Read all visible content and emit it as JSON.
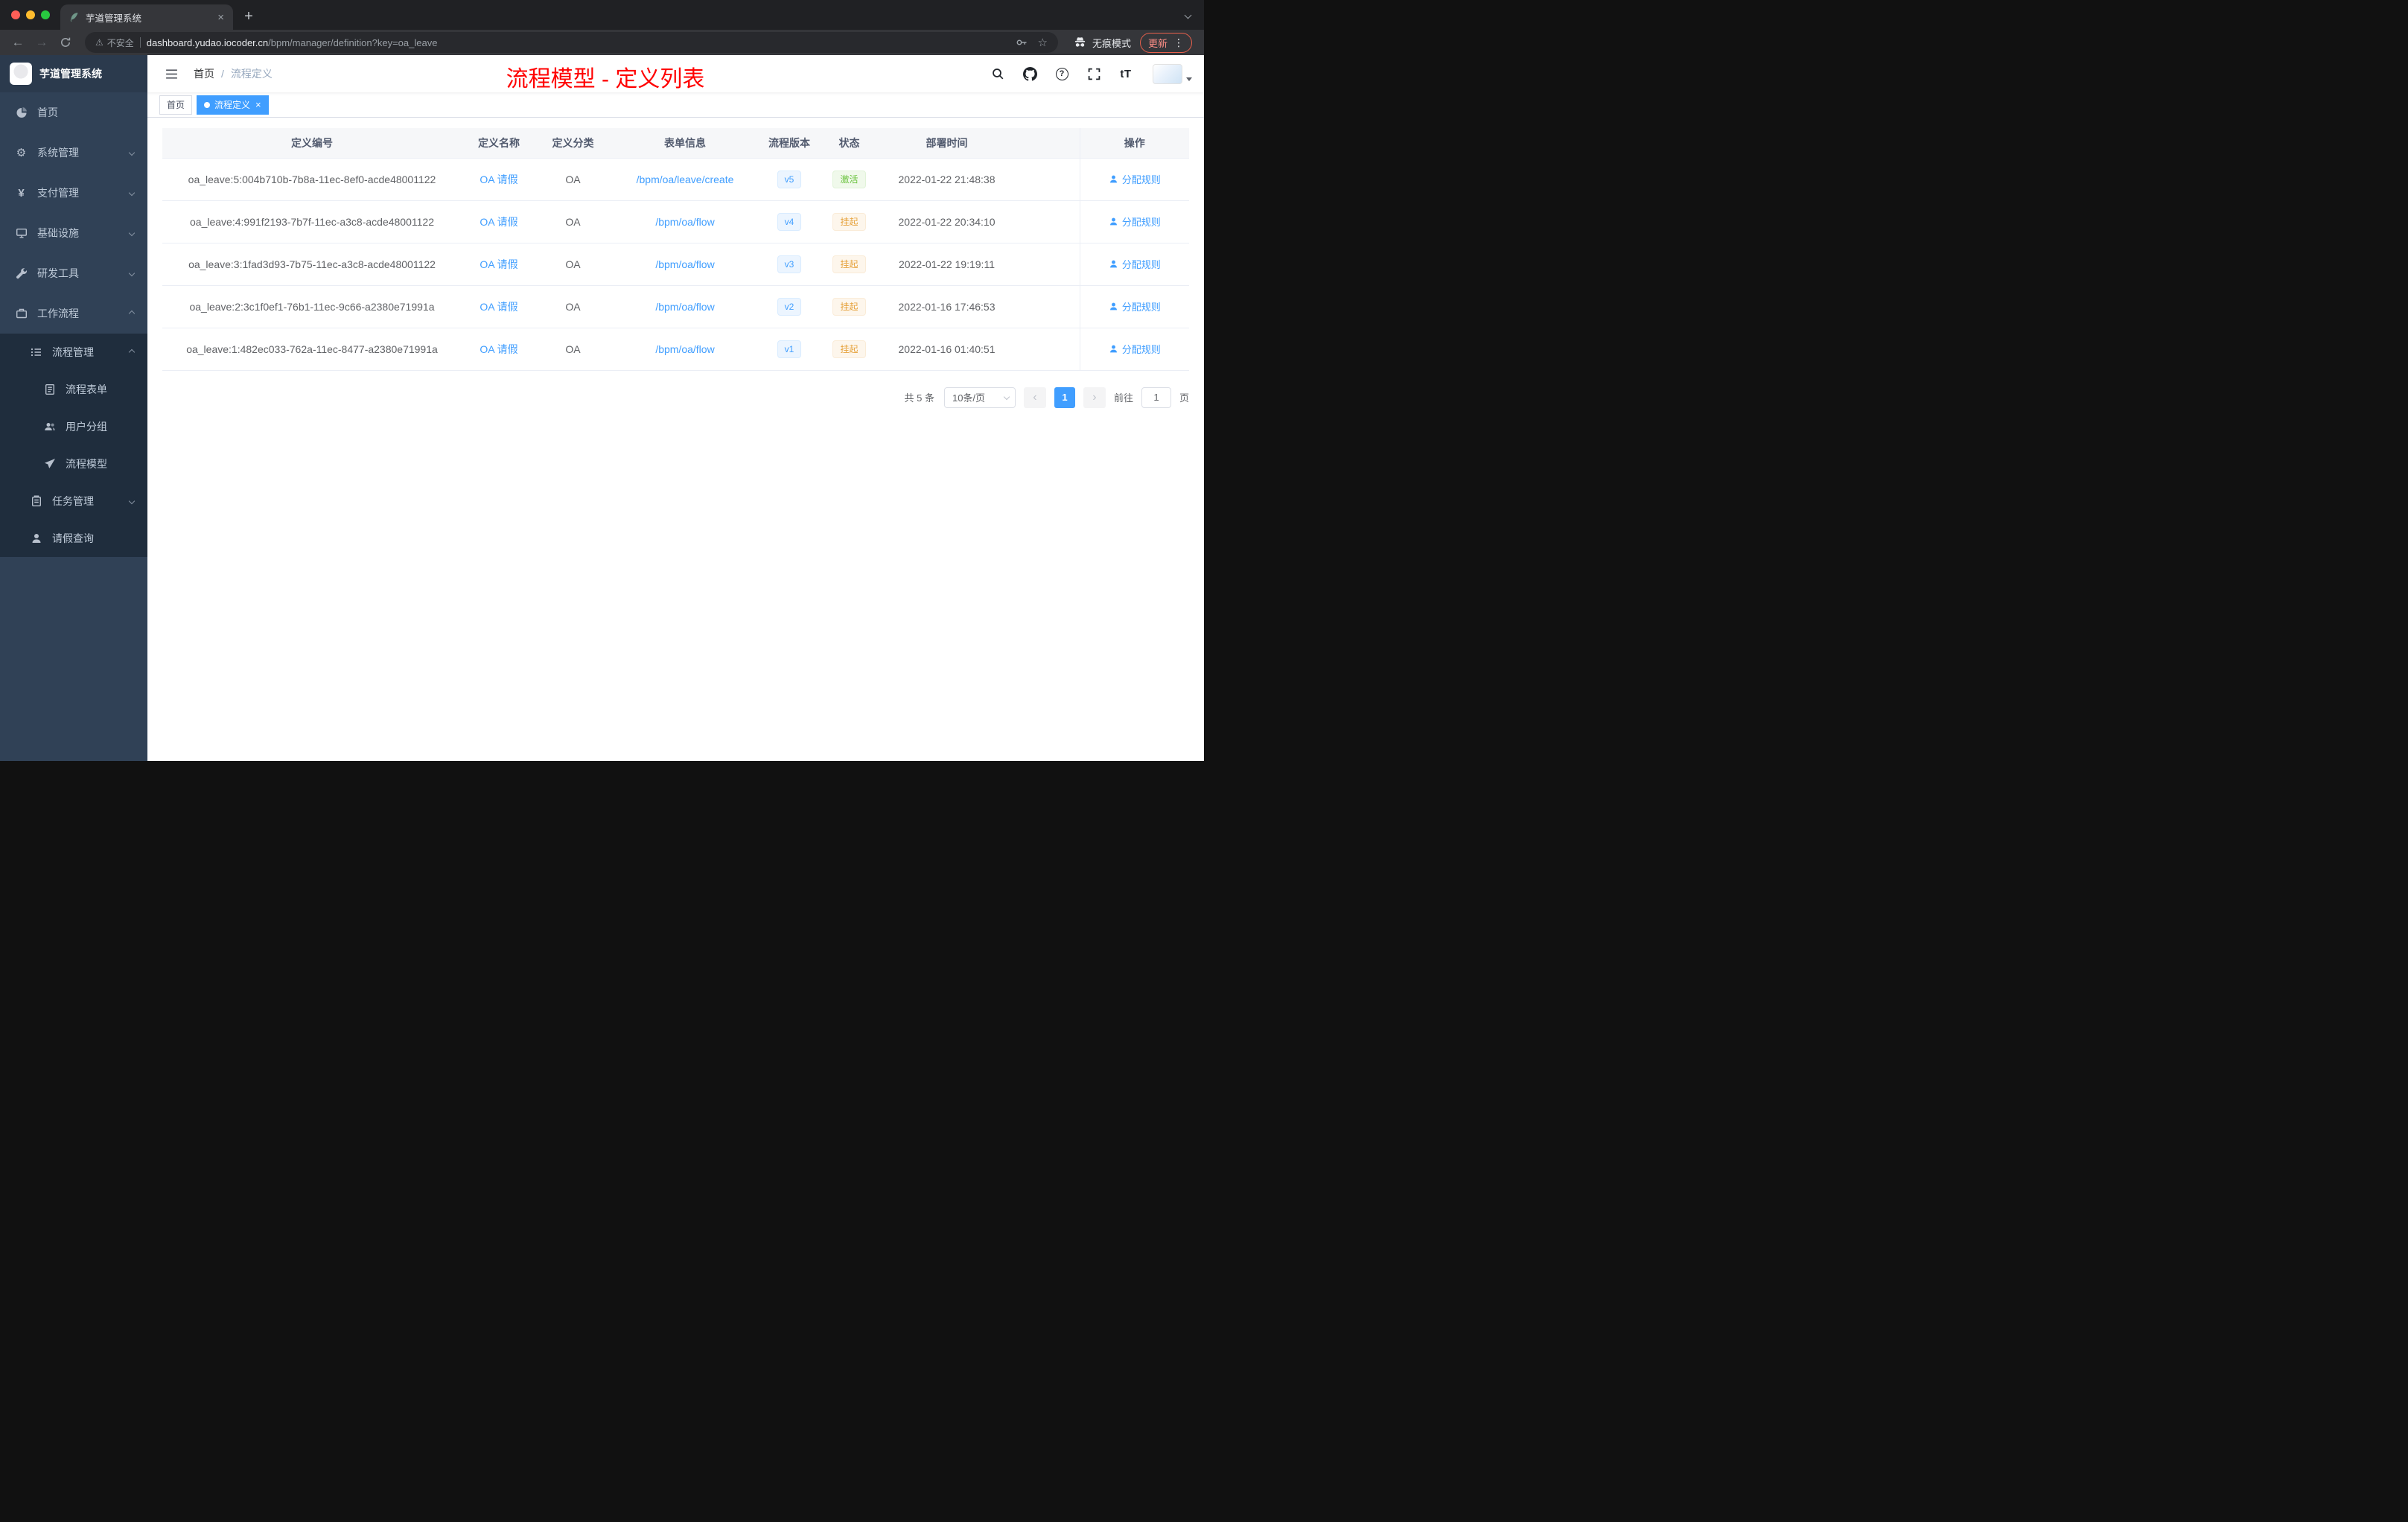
{
  "browser": {
    "tab_title": "芋道管理系统",
    "security_label": "不安全",
    "url_domain": "dashboard.yudao.iocoder.cn",
    "url_path": "/bpm/manager/definition?key=oa_leave",
    "incognito_label": "无痕模式",
    "update_label": "更新"
  },
  "icons": {
    "back": "←",
    "forward": "→",
    "close": "×",
    "plus": "+",
    "dots": "⋮",
    "star": "☆",
    "warning": "⚠",
    "question": "?",
    "font_size": "tT",
    "yen": "¥",
    "gear": "⚙",
    "prev": "‹",
    "next": "›"
  },
  "sidebar": {
    "logo_title": "芋道管理系统",
    "items": [
      {
        "label": "首页"
      },
      {
        "label": "系统管理"
      },
      {
        "label": "支付管理"
      },
      {
        "label": "基础设施"
      },
      {
        "label": "研发工具"
      },
      {
        "label": "工作流程"
      },
      {
        "label": "流程管理"
      },
      {
        "label": "流程表单"
      },
      {
        "label": "用户分组"
      },
      {
        "label": "流程模型"
      },
      {
        "label": "任务管理"
      },
      {
        "label": "请假查询"
      }
    ]
  },
  "header": {
    "breadcrumb_home": "首页",
    "breadcrumb_separator": "/",
    "breadcrumb_current": "流程定义",
    "annotation": "流程模型 - 定义列表"
  },
  "tags": [
    {
      "label": "首页"
    },
    {
      "label": "流程定义"
    }
  ],
  "table": {
    "columns": [
      "定义编号",
      "定义名称",
      "定义分类",
      "表单信息",
      "流程版本",
      "状态",
      "部署时间",
      "操作"
    ],
    "rows": [
      {
        "id": "oa_leave:5:004b710b-7b8a-11ec-8ef0-acde48001122",
        "name": "OA 请假",
        "category": "OA",
        "form": "/bpm/oa/leave/create",
        "version": "v5",
        "status": "激活",
        "deploy_time": "2022-01-22 21:48:38",
        "action": "分配规则"
      },
      {
        "id": "oa_leave:4:991f2193-7b7f-11ec-a3c8-acde48001122",
        "name": "OA 请假",
        "category": "OA",
        "form": "/bpm/oa/flow",
        "version": "v4",
        "status": "挂起",
        "deploy_time": "2022-01-22 20:34:10",
        "action": "分配规则"
      },
      {
        "id": "oa_leave:3:1fad3d93-7b75-11ec-a3c8-acde48001122",
        "name": "OA 请假",
        "category": "OA",
        "form": "/bpm/oa/flow",
        "version": "v3",
        "status": "挂起",
        "deploy_time": "2022-01-22 19:19:11",
        "action": "分配规则"
      },
      {
        "id": "oa_leave:2:3c1f0ef1-76b1-11ec-9c66-a2380e71991a",
        "name": "OA 请假",
        "category": "OA",
        "form": "/bpm/oa/flow",
        "version": "v2",
        "status": "挂起",
        "deploy_time": "2022-01-16 17:46:53",
        "action": "分配规则"
      },
      {
        "id": "oa_leave:1:482ec033-762a-11ec-8477-a2380e71991a",
        "name": "OA 请假",
        "category": "OA",
        "form": "/bpm/oa/flow",
        "version": "v1",
        "status": "挂起",
        "deploy_time": "2022-01-16 01:40:51",
        "action": "分配规则"
      }
    ]
  },
  "pagination": {
    "total": "共 5 条",
    "page_size": "10条/页",
    "current_page": "1",
    "goto_label": "前往",
    "goto_value": "1",
    "page_unit": "页"
  },
  "colors": {
    "accent": "#409eff",
    "status_active": "#67c23a",
    "status_suspended": "#e6a23c",
    "annotation_red": "#ff0000",
    "sidebar_bg": "#304156",
    "submenu_bg": "#1f2d3d"
  }
}
